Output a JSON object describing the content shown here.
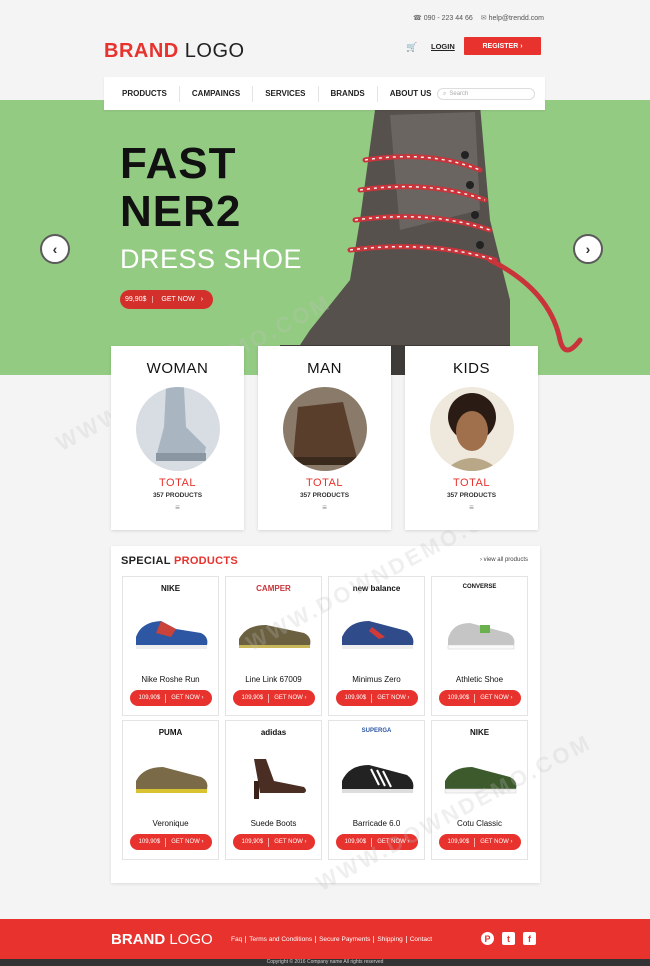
{
  "topbar": {
    "phone": "090 - 223 44 66",
    "email": "help@trendd.com",
    "login": "LOGIN",
    "register": "REGISTER ›"
  },
  "logo": {
    "brand": "BRAND",
    "logo": "LOGO"
  },
  "nav": {
    "items": [
      "PRODUCTS",
      "CAMPAINGS",
      "SERVICES",
      "BRANDS",
      "ABOUT US"
    ],
    "search_placeholder": "Search"
  },
  "hero": {
    "line1": "FAST",
    "line2": "NER2",
    "subtitle": "DRESS SHOE",
    "price": "99,90$",
    "cta": "GET NOW"
  },
  "categories": [
    {
      "title": "WOMAN",
      "total": "TOTAL",
      "count": "357 PRODUCTS"
    },
    {
      "title": "MAN",
      "total": "TOTAL",
      "count": "357 PRODUCTS"
    },
    {
      "title": "KIDS",
      "total": "TOTAL",
      "count": "357 PRODUCTS"
    }
  ],
  "special": {
    "title_a": "SPECIAL",
    "title_b": "PRODUCTS",
    "view_all": "› view all products",
    "products": [
      {
        "brand": "NIKE",
        "name": "Nike Roshe Run",
        "price": "109,90$",
        "cta": "GET NOW ›"
      },
      {
        "brand": "CAMPER",
        "name": "Line Link 67009",
        "price": "109,90$",
        "cta": "GET NOW ›"
      },
      {
        "brand": "new balance",
        "name": "Minimus Zero",
        "price": "109,90$",
        "cta": "GET NOW ›"
      },
      {
        "brand": "CONVERSE",
        "name": "Athletic Shoe",
        "price": "109,90$",
        "cta": "GET NOW ›"
      },
      {
        "brand": "PUMA",
        "name": "Veronique",
        "price": "109,90$",
        "cta": "GET NOW ›"
      },
      {
        "brand": "adidas",
        "name": "Suede Boots",
        "price": "109,90$",
        "cta": "GET NOW ›"
      },
      {
        "brand": "SUPERGA",
        "name": "Barricade 6.0",
        "price": "109,90$",
        "cta": "GET NOW ›"
      },
      {
        "brand": "NIKE",
        "name": "Cotu Classic",
        "price": "109,90$",
        "cta": "GET NOW ›"
      }
    ]
  },
  "footer": {
    "brand": "BRAND",
    "logo": "LOGO",
    "links": [
      "Faq",
      "Terms and Conditions",
      "Secure Payments",
      "Shipping",
      "Contact"
    ],
    "copyright": "Copyright © 2016 Company name All rights reserved"
  },
  "watermark": "WWW.DOWNDEMO.COM",
  "colors": {
    "accent": "#e8322d",
    "hero_bg": "#94cb83"
  }
}
